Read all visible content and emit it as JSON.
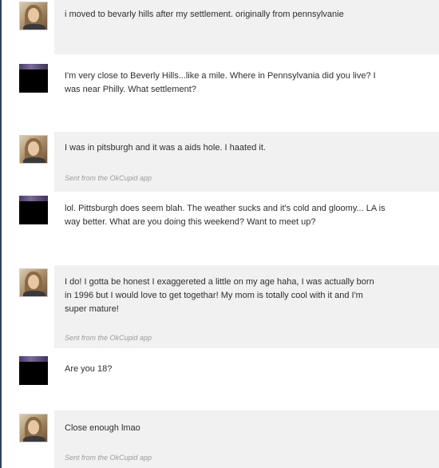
{
  "conversation": {
    "messages": [
      {
        "sender": "them",
        "text": "i moved to bevarly hills after my settlement. originally from pennsylvanie",
        "sent_from": ""
      },
      {
        "sender": "me",
        "text": "I'm very close to Beverly Hills...like a mile. Where in Pennsylvania did you live? I\nwas near Philly. What settlement?",
        "sent_from": ""
      },
      {
        "sender": "them",
        "text": "I was in pitsburgh and it was a aids hole. I haated it.",
        "sent_from": "Sent from the OkCupid app"
      },
      {
        "sender": "me",
        "text": "lol. Pittsburgh does seem blah. The weather sucks and it's cold and gloomy... LA is\nway better. What are you doing this weekend? Want to meet up?",
        "sent_from": ""
      },
      {
        "sender": "them",
        "text": "I do! I gotta be honest I exaggereted a little on my age haha, I was actually born\nin 1996 but I would love to get togethar! My mom is totally cool with it and I'm\nsuper mature!",
        "sent_from": "Sent from the OkCupid app"
      },
      {
        "sender": "me",
        "text": "Are you 18?",
        "sent_from": ""
      },
      {
        "sender": "them",
        "text": "Close enough lmao",
        "sent_from": "Sent from the OkCupid app"
      }
    ]
  }
}
